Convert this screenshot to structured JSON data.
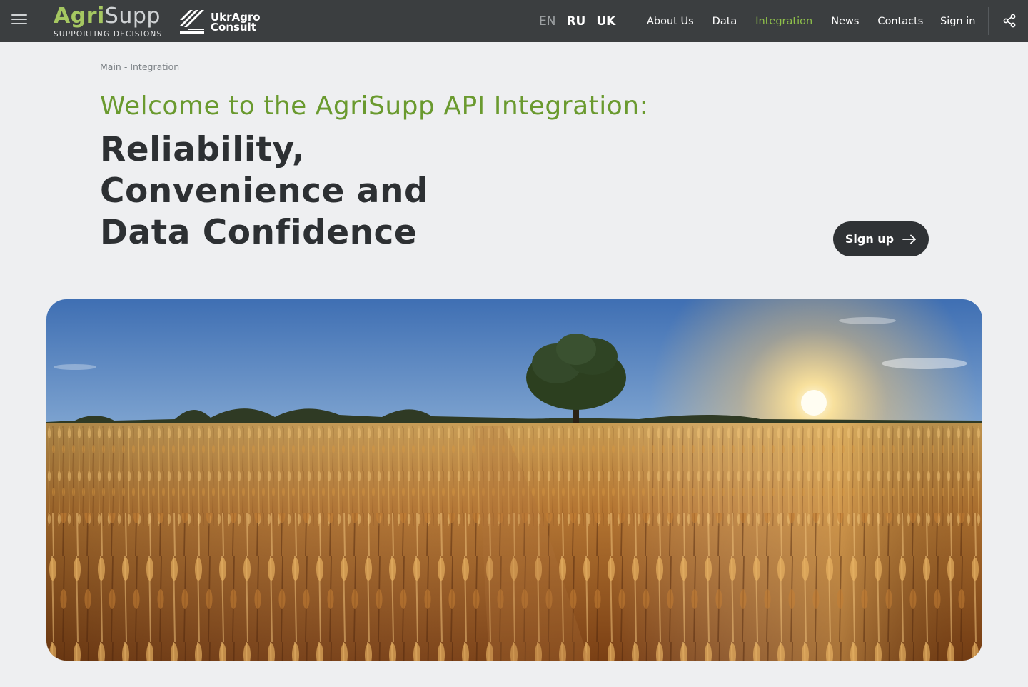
{
  "header": {
    "menu_icon": "hamburger-icon",
    "brand": {
      "name_part1": "Agri",
      "name_part2": "Supp",
      "tagline": "SUPPORTING DECISIONS"
    },
    "partner": {
      "line1": "UkrAgro",
      "line2": "Consult"
    },
    "languages": [
      {
        "label": "EN",
        "active": true
      },
      {
        "label": "RU",
        "active": false
      },
      {
        "label": "UK",
        "active": false
      }
    ],
    "nav": [
      {
        "label": "About Us",
        "active": false
      },
      {
        "label": "Data",
        "active": false
      },
      {
        "label": "Integration",
        "active": true
      },
      {
        "label": "News",
        "active": false
      },
      {
        "label": "Contacts",
        "active": false
      }
    ],
    "signin_label": "Sign in",
    "share_icon": "share-icon"
  },
  "breadcrumb": {
    "home": "Main",
    "separator": "-",
    "current": "Integration"
  },
  "main": {
    "welcome": "Welcome to the AgriSupp API Integration:",
    "headline_lines": [
      "Reliability,",
      "Convenience and",
      "Data Confidence"
    ],
    "signup_label": "Sign up",
    "signup_icon": "arrow-right-icon",
    "hero_image": "wheat-field-sunset-image"
  },
  "colors": {
    "header_bg": "#3b3e40",
    "accent_green": "#6a9a2f",
    "nav_active": "#8fc04a",
    "page_bg": "#eeeff1",
    "button_bg": "#2f3235"
  }
}
